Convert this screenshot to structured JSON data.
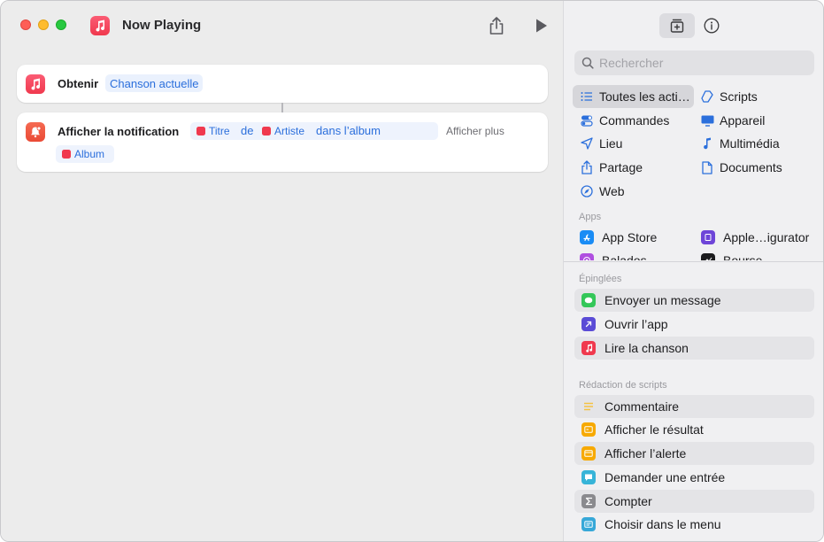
{
  "window": {
    "title": "Now Playing"
  },
  "colors": {
    "accent": "#2b6fdc",
    "music": "#f0394e",
    "notification": "#ea4a35",
    "token_bg": "#eaf1fd"
  },
  "editor": {
    "action1": {
      "label": "Obtenir",
      "token": "Chanson actuelle"
    },
    "action2": {
      "label": "Afficher la notification",
      "chip_title": "Titre",
      "word_de": "de",
      "chip_artist": "Artiste",
      "words_album": "dans l’album",
      "more": "Afficher plus",
      "chip_album": "Album"
    }
  },
  "sidebar": {
    "search_placeholder": "Rechercher",
    "categories": [
      {
        "label": "Toutes les acti…",
        "icon": "list-icon"
      },
      {
        "label": "Scripts",
        "icon": "scripts-icon"
      },
      {
        "label": "Commandes",
        "icon": "toggles-icon"
      },
      {
        "label": "Appareil",
        "icon": "display-icon"
      },
      {
        "label": "Lieu",
        "icon": "location-arrow-icon"
      },
      {
        "label": "Multimédia",
        "icon": "music-note-icon"
      },
      {
        "label": "Partage",
        "icon": "share-icon"
      },
      {
        "label": "Documents",
        "icon": "document-icon"
      },
      {
        "label": "Web",
        "icon": "compass-icon"
      }
    ],
    "apps_label": "Apps",
    "apps": [
      {
        "label": "App Store",
        "color": "#1a8cf5"
      },
      {
        "label": "Apple…igurator",
        "color": "#6e45d8"
      },
      {
        "label": "Balados",
        "color": "#b04fe0"
      },
      {
        "label": "Bourse",
        "color": "#1c1c1e"
      }
    ],
    "pinned_label": "Épinglées",
    "pinned": [
      {
        "label": "Envoyer un message",
        "color": "#34c759"
      },
      {
        "label": "Ouvrir l’app",
        "color": "#5a4bd6"
      },
      {
        "label": "Lire la chanson",
        "color": "#f0394e"
      }
    ],
    "scripting_label": "Rédaction de scripts",
    "scripting": [
      {
        "label": "Commentaire",
        "color": "#f5c242"
      },
      {
        "label": "Afficher le résultat",
        "color": "#f7a900"
      },
      {
        "label": "Afficher l’alerte",
        "color": "#f7a900"
      },
      {
        "label": "Demander une entrée",
        "color": "#37b4d8"
      },
      {
        "label": "Compter",
        "color": "#8a8a8e"
      },
      {
        "label": "Choisir dans le menu",
        "color": "#37a8d8"
      }
    ]
  }
}
